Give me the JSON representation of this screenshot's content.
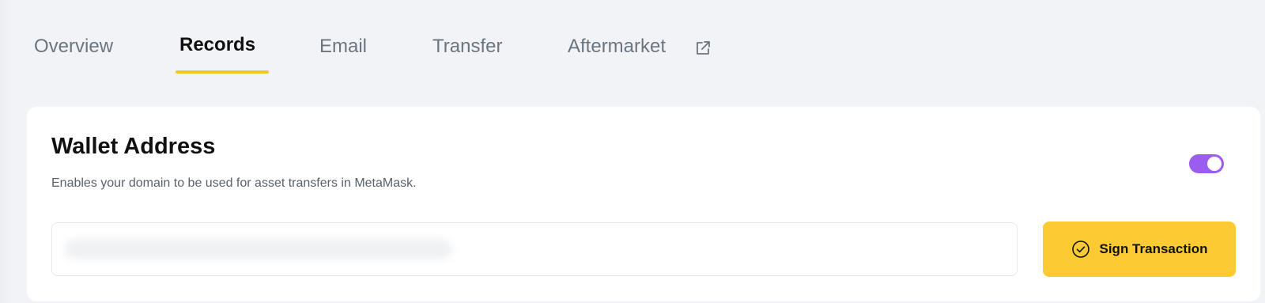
{
  "tabs": [
    {
      "label": "Overview",
      "active": false
    },
    {
      "label": "Records",
      "active": true
    },
    {
      "label": "Email",
      "active": false
    },
    {
      "label": "Transfer",
      "active": false
    },
    {
      "label": "Aftermarket",
      "active": false,
      "icon": "external-link-icon"
    }
  ],
  "wallet": {
    "title": "Wallet Address",
    "description": "Enables your domain to be used for asset transfers in MetaMask.",
    "toggle_on": true,
    "address_value_blurred": true,
    "sign_button_label": "Sign Transaction",
    "sign_button_icon": "check-circle-icon"
  },
  "colors": {
    "accent_yellow": "#fccb34",
    "tab_underline": "#f5c523",
    "toggle_purple": "#9b5cf0",
    "background": "#f2f3f6"
  }
}
